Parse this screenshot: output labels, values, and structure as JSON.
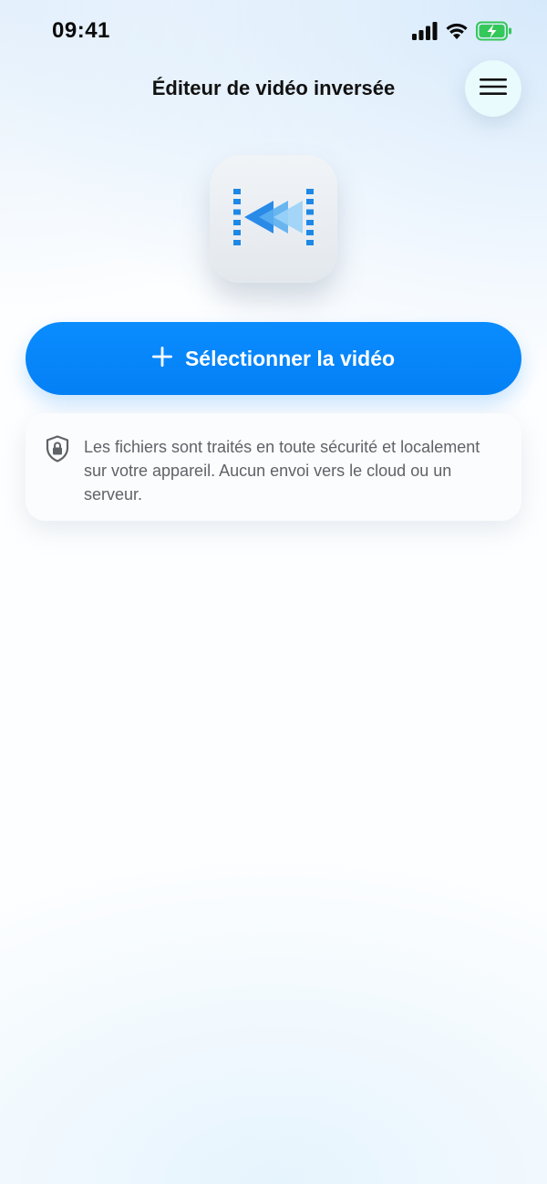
{
  "status_bar": {
    "time": "09:41",
    "icons": [
      "signal-icon",
      "wifi-icon",
      "battery-charging-icon"
    ],
    "battery_color": "#34c759"
  },
  "header": {
    "title": "Éditeur de vidéo inversée",
    "menu_icon": "hamburger-menu-icon"
  },
  "app_icon": {
    "icon": "reverse-video-icon",
    "accent": "#1e88e5"
  },
  "select_button": {
    "icon": "plus-icon",
    "label": "Sélectionner la vidéo",
    "color": "#0a8cff"
  },
  "info_card": {
    "icon": "shield-lock-icon",
    "text": "Les fichiers sont traités en toute sécurité et localement sur votre appareil. Aucun envoi vers le cloud ou un serveur."
  }
}
